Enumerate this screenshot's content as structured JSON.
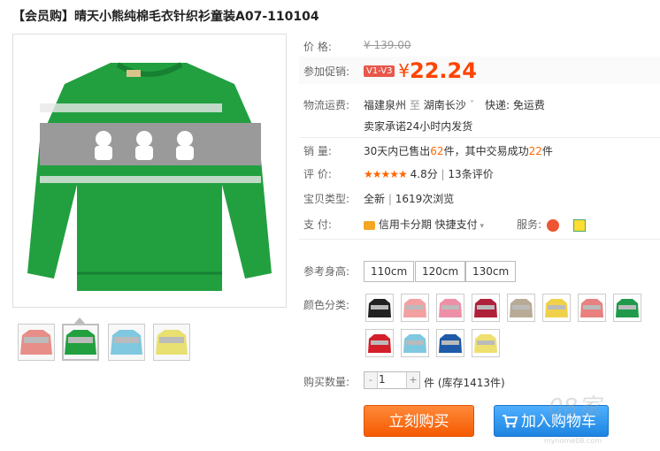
{
  "product": {
    "title": "【会员购】晴天小熊纯棉毛衣针织衫童装A07-110104",
    "price_label": "价    格:",
    "price_currency": "¥",
    "price_value": "139.00",
    "promo_label": "参加促销:",
    "promo_tag": "V1-V3",
    "promo_currency": "¥",
    "promo_value": "22.24",
    "shipping_label": "物流运费:",
    "ship_from": "福建泉州",
    "ship_sep": "至",
    "ship_to": "湖南长沙",
    "ship_method": "快递: 免运费",
    "ship_promise": "卖家承诺24小时内发货",
    "sales_label": "销    量:",
    "sales_pre": "30天内已售出",
    "sales_count": "62",
    "sales_mid": "件，其中交易成功",
    "sales_success": "22",
    "sales_unit": "件",
    "rating_label": "评    价:",
    "rating_stars": "★★★★★",
    "rating_score": "4.8分",
    "rating_sep": "|",
    "rating_reviews": "13条评价",
    "type_label": "宝贝类型:",
    "type_value": "全新",
    "type_sep": "|",
    "type_views": "1619次浏览",
    "pay_label": "支    付:",
    "pay_card": "信用卡分期",
    "pay_fast": "快捷支付",
    "service_label": "服务:",
    "size_label": "参考身高:",
    "sizes": [
      "110cm",
      "120cm",
      "130cm"
    ],
    "color_label": "颜色分类:",
    "colors": [
      "#222222",
      "#f2a0a0",
      "#ee8fa8",
      "#b0203a",
      "#b8ab96",
      "#f0d24a",
      "#e88080",
      "#1f9a4a",
      "#d3202a",
      "#7fc8e0",
      "#1e5aa8",
      "#eee070"
    ],
    "qty_label": "购买数量:",
    "qty_minus": "-",
    "qty_value": "1",
    "qty_plus": "+",
    "stock_text": "件 (库存1413件)",
    "buy_label": "立刻购买",
    "cart_label": "加入购物车",
    "thumbnail_colors": [
      "#e88e88",
      "#22a040",
      "#7fc8e0",
      "#e8e070"
    ]
  },
  "watermark": {
    "text": "08家",
    "url": "mynome08.com"
  }
}
